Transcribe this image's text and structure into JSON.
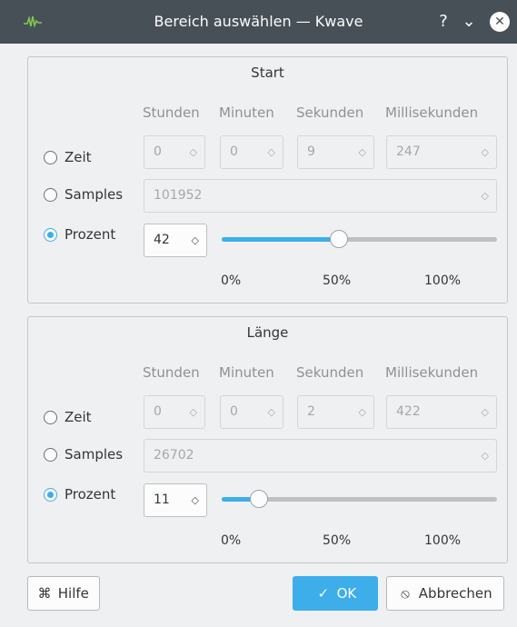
{
  "window": {
    "title": "Bereich auswählen — Kwave",
    "help_glyph": "?",
    "minimize_glyph": "⌄",
    "close_glyph": "✕"
  },
  "columns": [
    "Stunden",
    "Minuten",
    "Sekunden",
    "Millisekunden"
  ],
  "start": {
    "title": "Start",
    "time_label": "Zeit",
    "time_values": [
      "0",
      "0",
      "9",
      "247"
    ],
    "samples_label": "Samples",
    "samples_value": "101952",
    "percent_label": "Prozent",
    "percent_value": "42",
    "slider_percent": 42,
    "selected_mode": "Prozent",
    "ticks": [
      "0%",
      "50%",
      "100%"
    ]
  },
  "length": {
    "title": "Länge",
    "time_label": "Zeit",
    "time_values": [
      "0",
      "0",
      "2",
      "422"
    ],
    "samples_label": "Samples",
    "samples_value": "26702",
    "percent_label": "Prozent",
    "percent_value": "11",
    "slider_percent": 11,
    "selected_mode": "Prozent",
    "ticks": [
      "0%",
      "50%",
      "100%"
    ]
  },
  "buttons": {
    "help_label": "Hilfe",
    "help_icon": "help-icon",
    "ok_label": "OK",
    "ok_icon": "check-icon",
    "cancel_label": "Abbrechen",
    "cancel_icon": "cancel-icon"
  },
  "colors": {
    "accent": "#3daee9",
    "titlebar": "#475057",
    "background": "#eff0f1"
  }
}
